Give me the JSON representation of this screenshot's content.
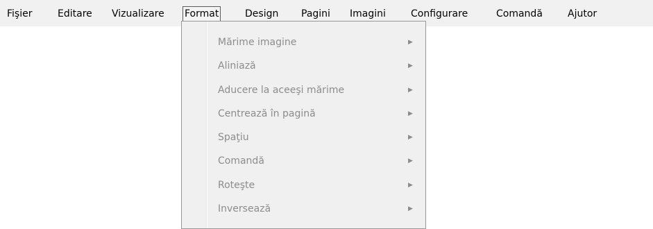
{
  "menubar": {
    "items": [
      {
        "label": "Fişier"
      },
      {
        "label": "Editare"
      },
      {
        "label": "Vizualizare"
      },
      {
        "label": "Format"
      },
      {
        "label": "Design"
      },
      {
        "label": "Pagini"
      },
      {
        "label": "Imagini"
      },
      {
        "label": "Configurare"
      },
      {
        "label": "Comandă"
      },
      {
        "label": "Ajutor"
      }
    ],
    "open_item": "Format"
  },
  "format_menu": {
    "items": [
      {
        "label": "Mărime imagine",
        "enabled": false,
        "submenu_icon": "submenu-arrow-icon"
      },
      {
        "label": "Aliniază",
        "enabled": false,
        "submenu_icon": "submenu-arrow-icon"
      },
      {
        "label": "Aducere la aceeşi mărime",
        "enabled": false,
        "submenu_icon": "submenu-arrow-icon"
      },
      {
        "label": "Centrează în pagină",
        "enabled": false,
        "submenu_icon": "submenu-arrow-icon"
      },
      {
        "label": "Spaţiu",
        "enabled": false,
        "submenu_icon": "submenu-arrow-icon"
      },
      {
        "label": "Comandă",
        "enabled": false,
        "submenu_icon": "submenu-arrow-icon"
      },
      {
        "label": "Roteşte",
        "enabled": false,
        "submenu_icon": "submenu-arrow-icon"
      },
      {
        "label": "Inversează",
        "enabled": false,
        "submenu_icon": "submenu-arrow-icon"
      }
    ]
  },
  "colors": {
    "menubar_background": "#f1f1f1",
    "dropdown_background": "#f0f0f0",
    "disabled_text": "#8c8c8c"
  }
}
